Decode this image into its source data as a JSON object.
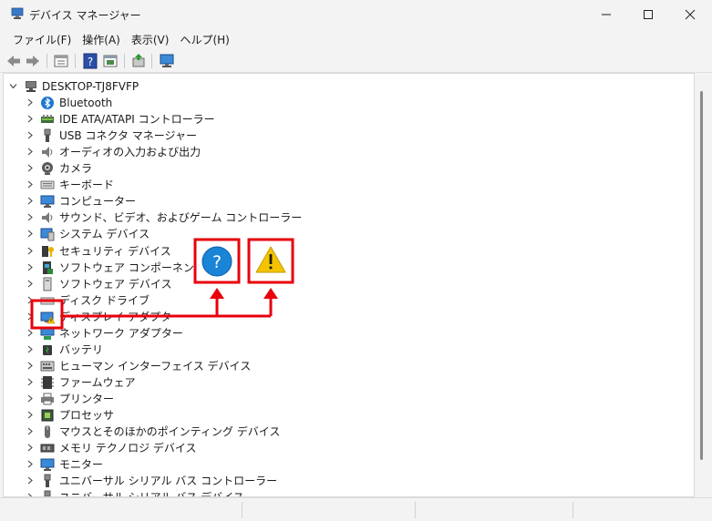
{
  "window": {
    "title": "デバイス マネージャー"
  },
  "menu": [
    {
      "label": "ファイル(F)"
    },
    {
      "label": "操作(A)"
    },
    {
      "label": "表示(V)"
    },
    {
      "label": "ヘルプ(H)"
    }
  ],
  "toolbar": {
    "icons": [
      "back-arrow-icon",
      "forward-arrow-icon",
      "properties-icon",
      "help-icon",
      "show-hidden-icon",
      "update-driver-icon",
      "scan-hardware-icon"
    ]
  },
  "tree": {
    "root": "DESKTOP-TJ8FVFP",
    "items": [
      {
        "label": "Bluetooth",
        "icon": "bluetooth-icon"
      },
      {
        "label": "IDE ATA/ATAPI コントローラー",
        "icon": "ide-controller-icon"
      },
      {
        "label": "USB コネクタ マネージャー",
        "icon": "usb-icon"
      },
      {
        "label": "オーディオの入力および出力",
        "icon": "speaker-icon"
      },
      {
        "label": "カメラ",
        "icon": "camera-icon"
      },
      {
        "label": "キーボード",
        "icon": "keyboard-icon"
      },
      {
        "label": "コンピューター",
        "icon": "monitor-icon"
      },
      {
        "label": "サウンド、ビデオ、およびゲーム コントローラー",
        "icon": "speaker-icon"
      },
      {
        "label": "システム デバイス",
        "icon": "system-device-icon"
      },
      {
        "label": "セキュリティ デバイス",
        "icon": "security-key-icon"
      },
      {
        "label": "ソフトウェア コンポーネント",
        "icon": "software-component-icon"
      },
      {
        "label": "ソフトウェア デバイス",
        "icon": "software-device-icon"
      },
      {
        "label": "ディスク ドライブ",
        "icon": "disk-drive-icon"
      },
      {
        "label": "ディスプレイ アダプター",
        "icon": "display-adapter-warning-icon"
      },
      {
        "label": "ネットワーク アダプター",
        "icon": "network-adapter-icon"
      },
      {
        "label": "バッテリ",
        "icon": "battery-icon"
      },
      {
        "label": "ヒューマン インターフェイス デバイス",
        "icon": "hid-icon"
      },
      {
        "label": "ファームウェア",
        "icon": "firmware-icon"
      },
      {
        "label": "プリンター",
        "icon": "printer-icon"
      },
      {
        "label": "プロセッサ",
        "icon": "processor-icon"
      },
      {
        "label": "マウスとそのほかのポインティング デバイス",
        "icon": "mouse-icon"
      },
      {
        "label": "メモリ テクノロジ デバイス",
        "icon": "memory-icon"
      },
      {
        "label": "モニター",
        "icon": "monitor-icon"
      },
      {
        "label": "ユニバーサル シリアル バス コントローラー",
        "icon": "usb-icon"
      },
      {
        "label": "ユニバーサル シリアル バス デバイス",
        "icon": "usb-icon"
      }
    ]
  },
  "annotation": {
    "callout_icons": [
      "question-mark-icon",
      "warning-triangle-icon"
    ],
    "colors": {
      "callout_red": "#e8000b",
      "question_blue": "#1a84d6",
      "warning_yellow": "#f5c400"
    }
  }
}
